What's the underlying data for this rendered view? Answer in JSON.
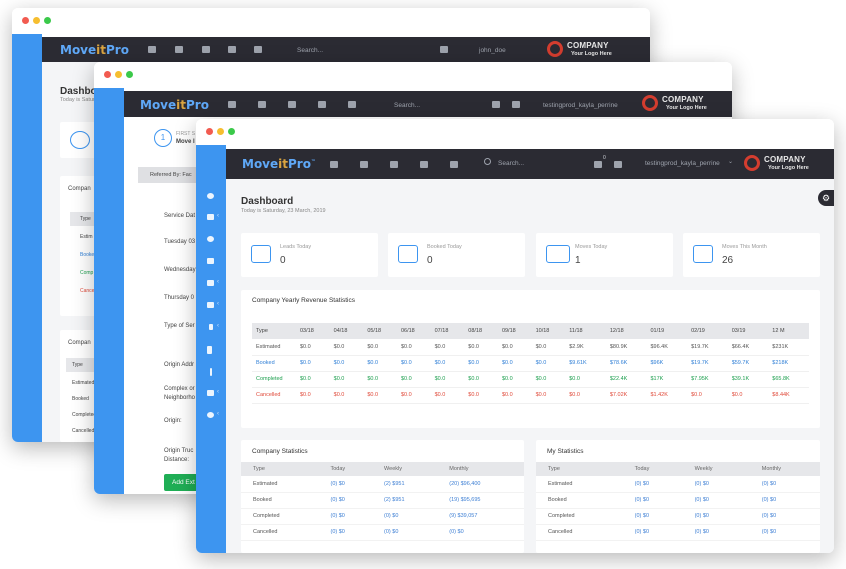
{
  "brand": {
    "logo_text": "Move",
    "logo_mid": "it",
    "logo_end": "Pro",
    "company_name": "COMPANY",
    "company_tagline": "Your Logo Here"
  },
  "win1": {
    "search_placeholder": "Search...",
    "username": "john_doe",
    "page_title": "Dashbo",
    "subtitle": "Today is Saturday",
    "section_a": "Compan",
    "table_header": "Type",
    "rows": [
      "Estim",
      "Booked",
      "Comp",
      "Cancell"
    ],
    "section_b": "Compan",
    "table_header_b": "Type",
    "rows_b": [
      "Estimated",
      "Booked",
      "Completed",
      "Cancelled"
    ]
  },
  "win2": {
    "search_placeholder": "Search...",
    "username": "testingprod_kayla_perrine",
    "step_num": "1",
    "step_label_small": "FIRST S",
    "step_label": "Move I",
    "referred": "Referred By: Fac",
    "labels": [
      "Service Dat",
      "Tuesday 03",
      "Wednesday",
      "Thursday 0",
      "Type of Ser",
      "Origin Addr",
      "Complex or",
      "Neighborho",
      "Origin:",
      "Origin Truc",
      "Distance:"
    ],
    "add_button": "Add Ext"
  },
  "win3": {
    "search_placeholder": "Search...",
    "username": "testingprod_kayla_perrine",
    "badge_count": "0",
    "page_title": "Dashboard",
    "subtitle": "Today is Saturday, 23 March, 2019",
    "stats": [
      {
        "label": "Leads Today",
        "value": "0",
        "icon": "leads-icon"
      },
      {
        "label": "Booked Today",
        "value": "0",
        "icon": "laptop-icon"
      },
      {
        "label": "Moves Today",
        "value": "1",
        "icon": "truck-icon"
      },
      {
        "label": "Moves This Month",
        "value": "26",
        "icon": "calendar-icon"
      }
    ],
    "revenue": {
      "title": "Company Yearly Revenue Statistics",
      "columns": [
        "Type",
        "03/18",
        "04/18",
        "05/18",
        "06/18",
        "07/18",
        "08/18",
        "09/18",
        "10/18",
        "11/18",
        "12/18",
        "01/19",
        "02/19",
        "03/19",
        "12 M"
      ],
      "rows": [
        {
          "type": "Estimated",
          "values": [
            "$0.0",
            "$0.0",
            "$0.0",
            "$0.0",
            "$0.0",
            "$0.0",
            "$0.0",
            "$0.0",
            "$2.9K",
            "$80.9K",
            "$96.4K",
            "$19.7K",
            "$66.4K",
            "$231K"
          ],
          "color": "#555555"
        },
        {
          "type": "Booked",
          "values": [
            "$0.0",
            "$0.0",
            "$0.0",
            "$0.0",
            "$0.0",
            "$0.0",
            "$0.0",
            "$0.0",
            "$9.61K",
            "$78.6K",
            "$96K",
            "$19.7K",
            "$59.7K",
            "$218K"
          ],
          "color": "#2f7fd6"
        },
        {
          "type": "Completed",
          "values": [
            "$0.0",
            "$0.0",
            "$0.0",
            "$0.0",
            "$0.0",
            "$0.0",
            "$0.0",
            "$0.0",
            "$0.0",
            "$22.4K",
            "$17K",
            "$7.95K",
            "$39.1K",
            "$65.8K"
          ],
          "color": "#1fa050"
        },
        {
          "type": "Cancelled",
          "values": [
            "$0.0",
            "$0.0",
            "$0.0",
            "$0.0",
            "$0.0",
            "$0.0",
            "$0.0",
            "$0.0",
            "$0.0",
            "$7.02K",
            "$1.42K",
            "$0.0",
            "$0.0",
            "$8.44K"
          ],
          "color": "#e04a3a"
        }
      ]
    },
    "company_stats": {
      "title": "Company Statistics",
      "columns": [
        "Type",
        "Today",
        "Weekly",
        "Monthly"
      ],
      "rows": [
        [
          "Estimated",
          "(0) $0",
          "(2) $951",
          "(20) $96,400"
        ],
        [
          "Booked",
          "(0) $0",
          "(2) $951",
          "(19) $95,695"
        ],
        [
          "Completed",
          "(0) $0",
          "(0) $0",
          "(9) $39,057"
        ],
        [
          "Cancelled",
          "(0) $0",
          "(0) $0",
          "(0) $0"
        ]
      ]
    },
    "my_stats": {
      "title": "My Statistics",
      "columns": [
        "Type",
        "Today",
        "Weekly",
        "Monthly"
      ],
      "rows": [
        [
          "Estimated",
          "(0) $0",
          "(0) $0",
          "(0) $0"
        ],
        [
          "Booked",
          "(0) $0",
          "(0) $0",
          "(0) $0"
        ],
        [
          "Completed",
          "(0) $0",
          "(0) $0",
          "(0) $0"
        ],
        [
          "Cancelled",
          "(0) $0",
          "(0) $0",
          "(0) $0"
        ]
      ]
    }
  },
  "colors": {
    "sidebar": "#3d95f0",
    "topbar": "#2b2b33",
    "accent": "#5fa8f7"
  }
}
